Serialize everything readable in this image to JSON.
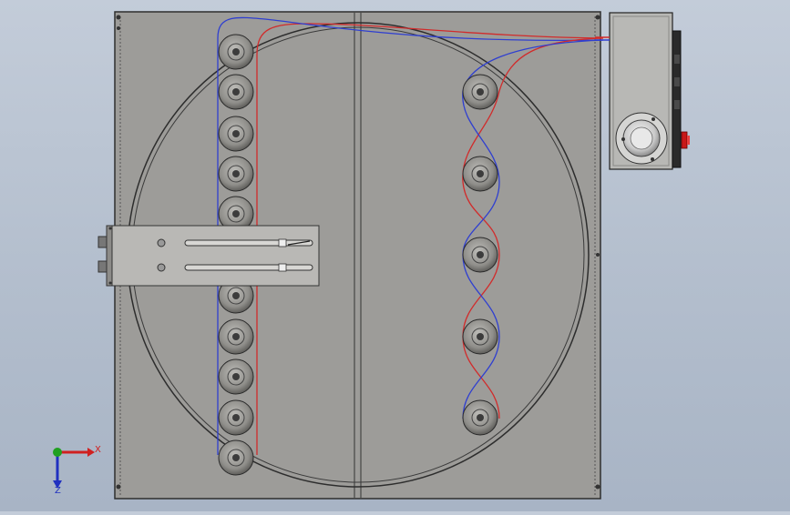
{
  "window": {
    "title": ""
  },
  "colors": {
    "background_top": "#c3ccd9",
    "background_bottom": "#a8b4c5",
    "panel": "#9d9c99",
    "panel_edge": "#2e2e2e",
    "wire_red": "#d12b2b",
    "wire_blue": "#2f3fd0",
    "axis_x": "#d02020",
    "axis_y": "#20a020",
    "axis_z": "#2030c0",
    "estop": "#c81818"
  },
  "icons": {
    "rollers": "roller-icon",
    "estop": "emergency-stop-icon",
    "triad": "coordinate-triad-icon"
  },
  "triad": {
    "x_label": "X",
    "z_label": "Z"
  }
}
